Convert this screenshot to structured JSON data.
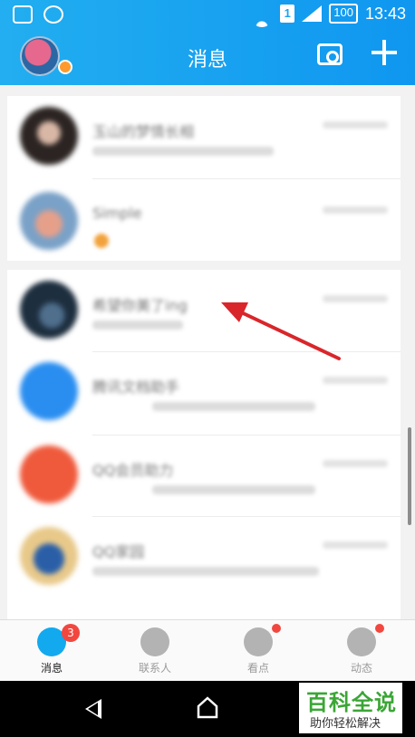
{
  "status_bar": {
    "battery": "100",
    "time": "13:43",
    "sim_slot": "1"
  },
  "header": {
    "title": "消息"
  },
  "chats": [
    {
      "name": "玉山的梦情长相"
    },
    {
      "name": "Simple"
    },
    {
      "name": "希望你美了ing"
    },
    {
      "name": "腾讯文档助手"
    },
    {
      "name": "QQ会员助力"
    },
    {
      "name": "QQ家园"
    }
  ],
  "bottom_nav": {
    "items": [
      {
        "label": "消息",
        "badge": "3"
      },
      {
        "label": "联系人"
      },
      {
        "label": "看点"
      },
      {
        "label": "动态"
      }
    ]
  },
  "watermark": {
    "title": "百科全说",
    "subtitle": "助你轻松解决"
  },
  "colors": {
    "header": "#1aa5ef",
    "accent": "#12a9ef",
    "badge": "#f2473f",
    "arrow": "#d9262b"
  }
}
